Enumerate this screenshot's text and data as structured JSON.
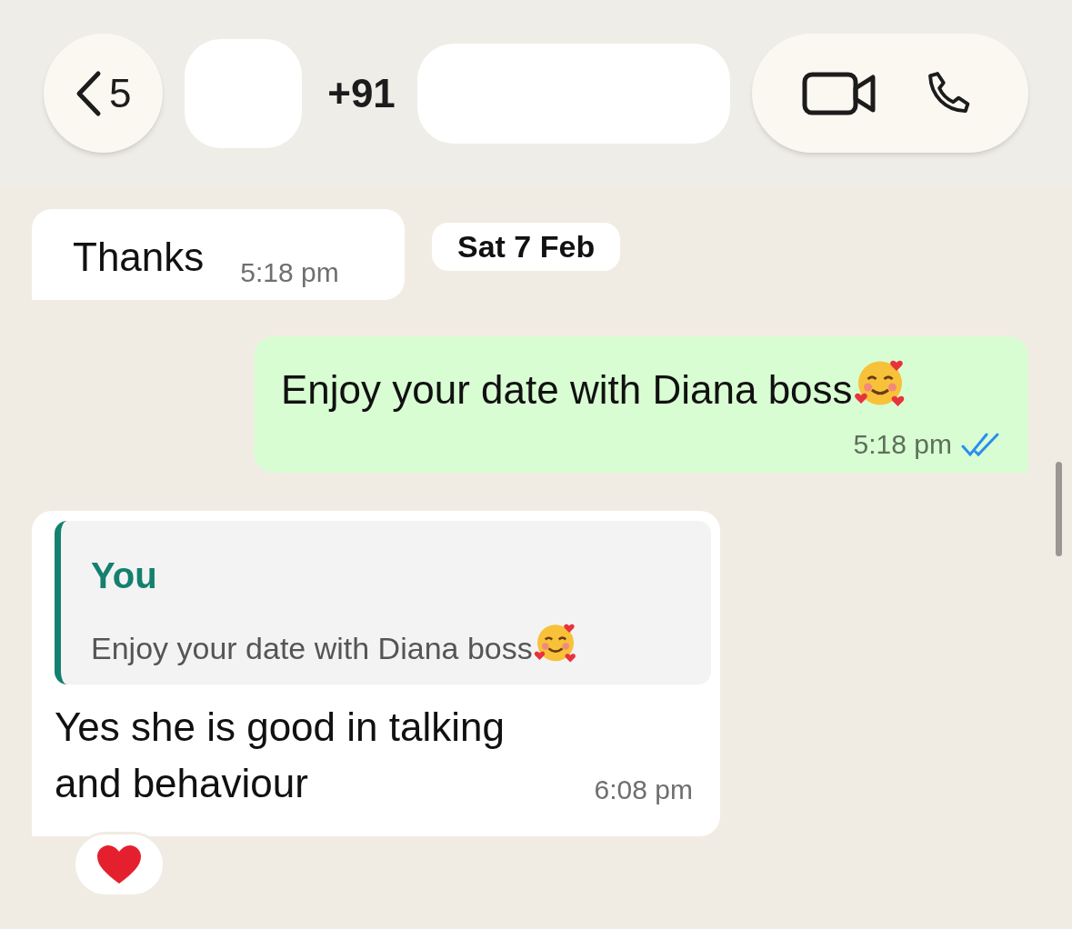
{
  "header": {
    "back_count": "5",
    "contact": "+91"
  },
  "messages": [
    {
      "kind": "received",
      "text": "Thanks",
      "time": "5:18 pm"
    },
    {
      "kind": "date",
      "text": "Sat 7 Feb"
    },
    {
      "kind": "sent",
      "text": "Enjoy your date with Diana boss",
      "time": "5:18 pm",
      "read": true
    },
    {
      "kind": "reply",
      "quote_author": "You",
      "quote_text": "Enjoy your date with Diana boss",
      "text": "Yes she is good in talking and behaviour",
      "time": "6:08 pm",
      "reaction": true
    }
  ]
}
